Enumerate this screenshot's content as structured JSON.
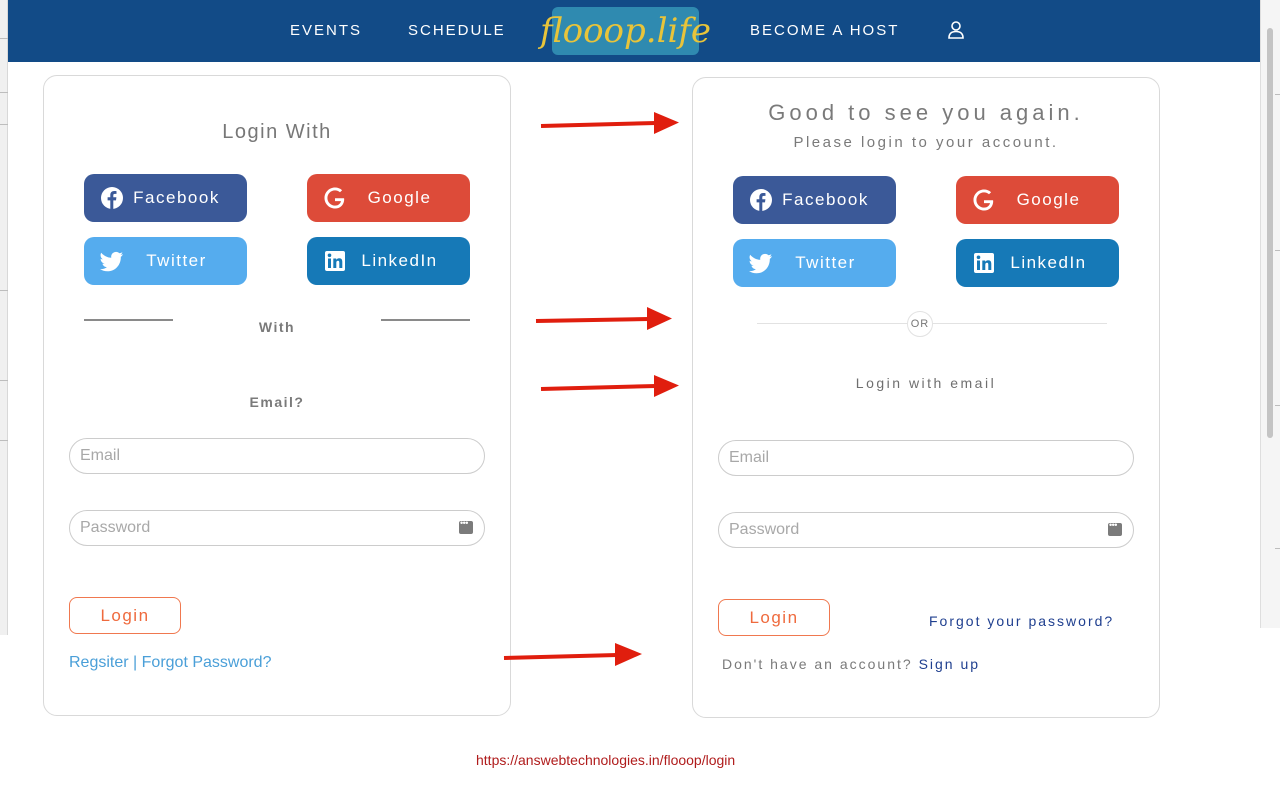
{
  "nav": {
    "events": "EVENTS",
    "schedule": "SCHEDULE",
    "logo": "flooop.life",
    "become_host": "BECOME A HOST"
  },
  "left_card": {
    "title": "Login With",
    "facebook": "Facebook",
    "google": "Google",
    "twitter": "Twitter",
    "linkedin": "LinkedIn",
    "with_label": "With",
    "email_label": "Email?",
    "email_placeholder": "Email",
    "password_placeholder": "Password",
    "login": "Login",
    "register": "Regsiter",
    "separator": "|",
    "forgot": "Forgot Password?"
  },
  "right_card": {
    "title": "Good to see you again.",
    "subtitle": "Please login to your account.",
    "facebook": "Facebook",
    "google": "Google",
    "twitter": "Twitter",
    "linkedin": "LinkedIn",
    "or": "OR",
    "login_with_email": "Login with email",
    "email_placeholder": "Email",
    "password_placeholder": "Password",
    "login": "Login",
    "forgot": "Forgot your password?",
    "no_account": "Don't have an account?",
    "signup": "Sign up"
  },
  "footer_url": "https://answebtechnologies.in/flooop/login",
  "colors": {
    "nav_bg": "#124b87",
    "facebook": "#3b5998",
    "google": "#dd4b39",
    "twitter": "#55acee",
    "linkedin": "#1679b7",
    "login_accent": "#ef6a3d",
    "arrow": "#e01e0e",
    "link_blue": "#4a9fd8",
    "link_navy": "#1f3f8f"
  }
}
